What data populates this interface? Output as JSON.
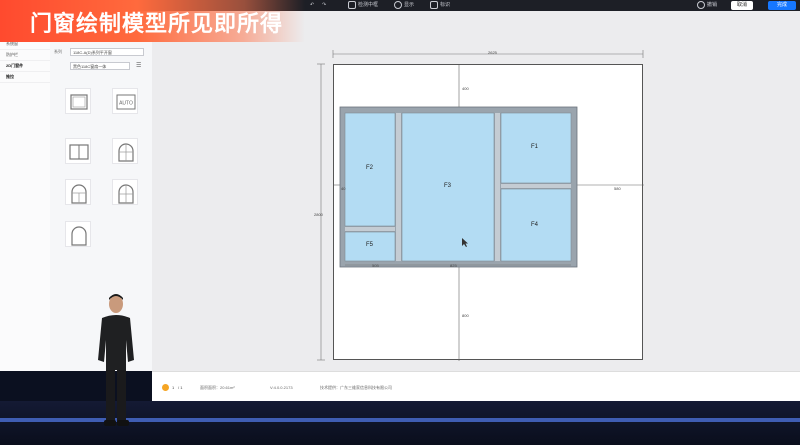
{
  "title": "门窗绘制模型所见即所得",
  "toolbar": {
    "undo_icon": "undo-icon",
    "redo_icon": "redo-icon",
    "items": [
      "检测中框",
      "显示",
      "标识"
    ],
    "right_label": "撤销",
    "cancel_label": "取消",
    "done_label": "完成"
  },
  "left_menu": {
    "items": [
      {
        "label": "系统窗",
        "selected": false
      },
      {
        "label": "防护栏",
        "selected": false
      },
      {
        "label": "2D门窗件",
        "selected": true
      },
      {
        "label": "推拉",
        "selected": true
      }
    ]
  },
  "series_panel": {
    "series_label": "系列",
    "series_value": "118C-A(D)系列平开窗",
    "color_value": "黑色118C窗扇一体"
  },
  "drawing": {
    "total_width": "2625",
    "total_height": "2800",
    "top_offset": "400",
    "bottom_offset": "800",
    "right_offset": "580",
    "left_offset": "40",
    "bottom_seg1": "505",
    "bottom_seg2": "825",
    "panes": [
      "F1",
      "F2",
      "F3",
      "F4",
      "F5"
    ]
  },
  "status_bar": {
    "page": "1",
    "page_sep": "/ 1",
    "area": "面积面积：20.61m²",
    "version": "V:4.0.0.2173",
    "support": "技术提供：广东三维家信息科技有限公司"
  },
  "colors": {
    "accent": "#ff4a2e",
    "glass": "#b3dcf3",
    "frame": "#9aa4ad",
    "primary_button": "#1677ff"
  }
}
